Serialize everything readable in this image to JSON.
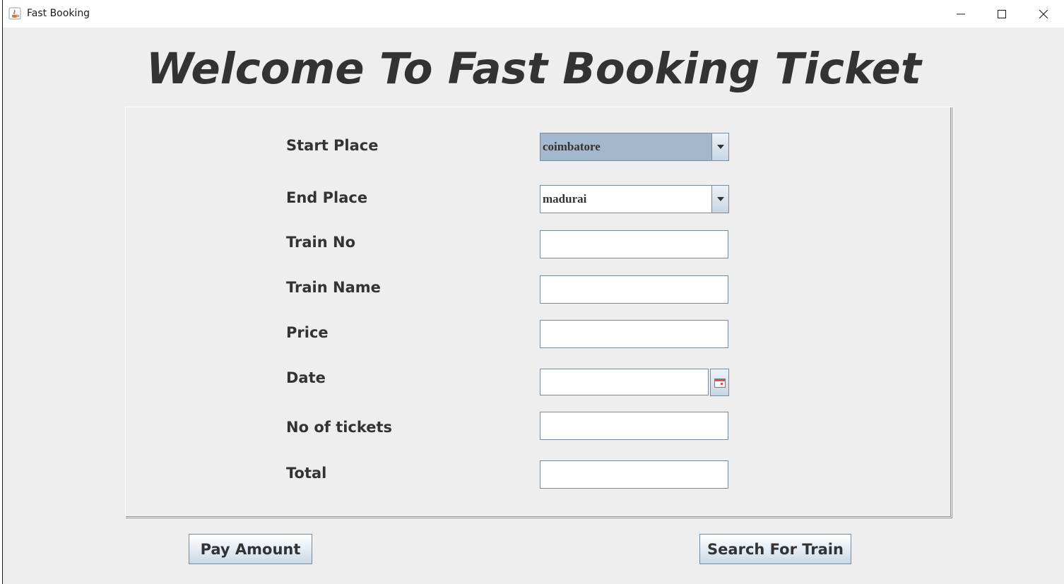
{
  "window": {
    "title": "Fast Booking",
    "controls": [
      "minimize-icon",
      "maximize-icon",
      "close-icon"
    ]
  },
  "heading": "Welcome To Fast Booking Ticket",
  "form": {
    "start_place": {
      "label": "Start Place",
      "value": "coimbatore"
    },
    "end_place": {
      "label": "End Place",
      "value": "madurai"
    },
    "train_no": {
      "label": "Train No",
      "value": ""
    },
    "train_name": {
      "label": "Train Name",
      "value": ""
    },
    "price": {
      "label": "Price",
      "value": ""
    },
    "date": {
      "label": "Date",
      "value": "",
      "icon": "calendar-icon"
    },
    "no_of_tickets": {
      "label": "No of tickets",
      "value": ""
    },
    "total": {
      "label": "Total",
      "value": ""
    }
  },
  "buttons": {
    "pay_amount": "Pay Amount",
    "search_for_train": "Search For Train"
  },
  "colors": {
    "background": "#eeeeee",
    "selected_combo": "#a3b8cc",
    "text": "#333333"
  }
}
